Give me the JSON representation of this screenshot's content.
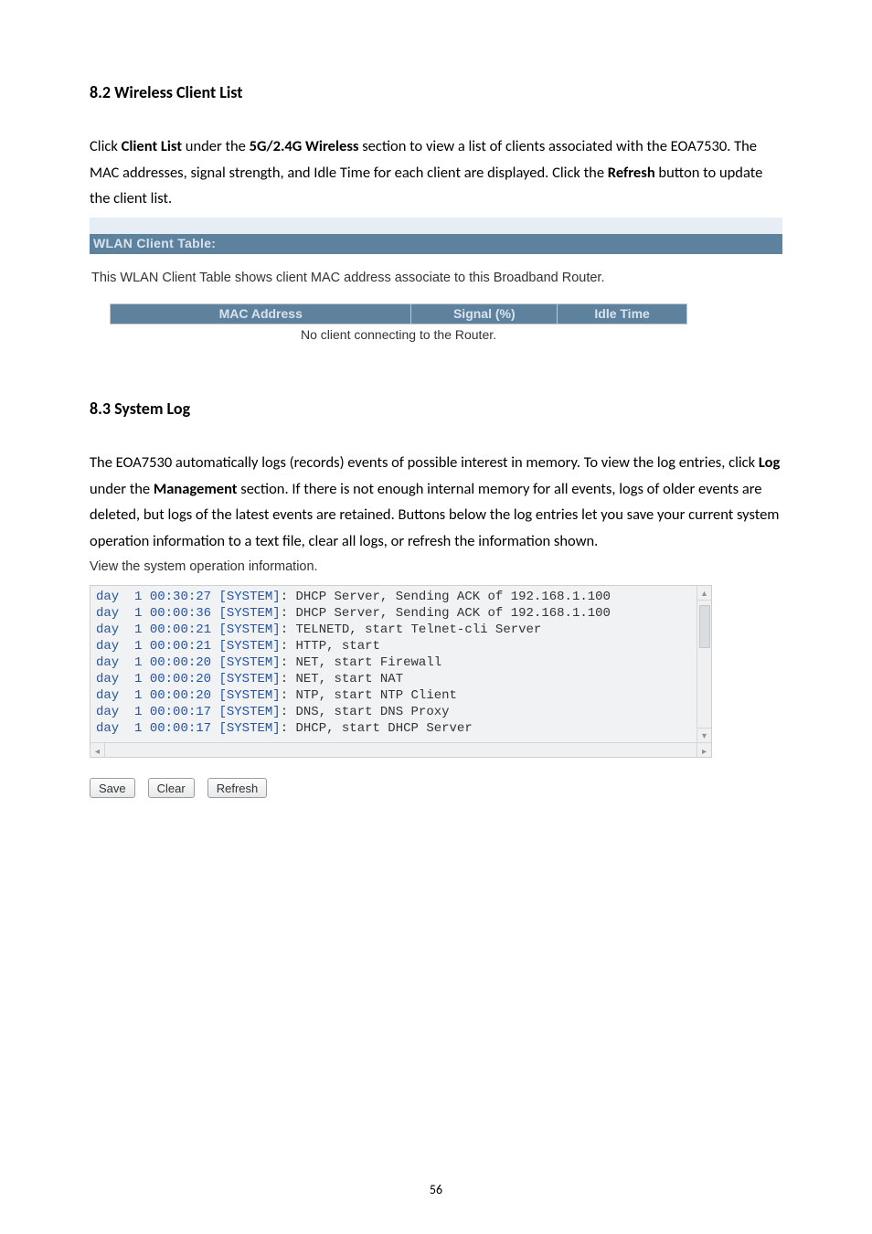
{
  "sec82": {
    "heading": "8.2 Wireless Client List",
    "p": {
      "pre": "Click ",
      "bold1": "Client List",
      "mid1": " under the ",
      "bold2": "5G/2.4G Wireless",
      "mid2": " section to view a list of clients associated with the EOA7530. The MAC addresses, signal strength, and Idle Time for each client are displayed. Click the ",
      "bold3": "Refresh",
      "post": " button to update the client list."
    },
    "panel_title": "WLAN Client Table:",
    "panel_caption": "This WLAN Client Table shows client MAC address associate to this Broadband Router.",
    "cols": [
      "MAC Address",
      "Signal (%)",
      "Idle Time"
    ],
    "empty": "No client connecting to the Router."
  },
  "sec83": {
    "heading": "8.3 System Log",
    "p": {
      "pre": "The EOA7530 automatically logs (records) events of possible interest in memory. To view the log entries, click ",
      "bold1": "Log",
      "mid1": " under the ",
      "bold2": "Management",
      "post": " section. If there is not enough internal memory for all events, logs of older events are deleted, but logs of the latest events are retained. Buttons below the log entries let you save your current system operation information to a text file, clear all logs, or refresh the information shown."
    },
    "caption": "View the system operation information.",
    "log_lines": [
      {
        "d": "day",
        "n": "1",
        "t": "00:30:27",
        "src": "[SYSTEM]",
        "msg": ": DHCP Server, Sending ACK of 192.168.1.100"
      },
      {
        "d": "day",
        "n": "1",
        "t": "00:00:36",
        "src": "[SYSTEM]",
        "msg": ": DHCP Server, Sending ACK of 192.168.1.100"
      },
      {
        "d": "day",
        "n": "1",
        "t": "00:00:21",
        "src": "[SYSTEM]",
        "msg": ": TELNETD, start Telnet-cli Server"
      },
      {
        "d": "day",
        "n": "1",
        "t": "00:00:21",
        "src": "[SYSTEM]",
        "msg": ": HTTP, start"
      },
      {
        "d": "day",
        "n": "1",
        "t": "00:00:20",
        "src": "[SYSTEM]",
        "msg": ": NET, start Firewall"
      },
      {
        "d": "day",
        "n": "1",
        "t": "00:00:20",
        "src": "[SYSTEM]",
        "msg": ": NET, start NAT"
      },
      {
        "d": "day",
        "n": "1",
        "t": "00:00:20",
        "src": "[SYSTEM]",
        "msg": ": NTP, start NTP Client"
      },
      {
        "d": "day",
        "n": "1",
        "t": "00:00:17",
        "src": "[SYSTEM]",
        "msg": ": DNS, start DNS Proxy"
      },
      {
        "d": "day",
        "n": "1",
        "t": "00:00:17",
        "src": "[SYSTEM]",
        "msg": ": DHCP, start DHCP Server"
      }
    ],
    "btns": [
      "Save",
      "Clear",
      "Refresh"
    ]
  },
  "page_num": "56"
}
